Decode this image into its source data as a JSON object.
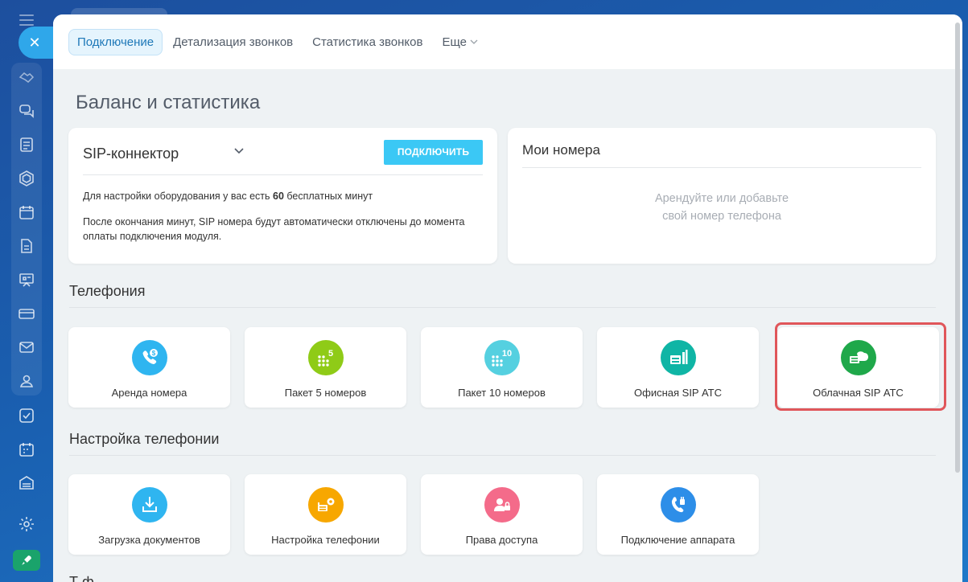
{
  "rail": {
    "close_glyph": "✕",
    "icons": [
      "handshake-icon",
      "chat-icon",
      "feed-icon",
      "hexagon-icon",
      "calendar-icon",
      "document-icon",
      "presentation-icon",
      "card-icon",
      "mail-icon",
      "contacts-icon",
      "task-icon",
      "schedule-icon",
      "storage-icon",
      "settings-icon",
      "rocket-icon"
    ]
  },
  "tabs": [
    {
      "label": "Подключение",
      "active": true
    },
    {
      "label": "Детализация звонков",
      "active": false
    },
    {
      "label": "Статистика звонков",
      "active": false
    },
    {
      "label": "Еще",
      "active": false
    }
  ],
  "page_title": "Баланс и статистика",
  "sip": {
    "title": "SIP-коннектор",
    "button": "ПОДКЛЮЧИТЬ",
    "line1_prefix": "Для настройки оборудования у вас есть ",
    "line1_bold": "60",
    "line1_suffix": " бесплатных минут",
    "line2": "После окончания минут, SIP номера будут автоматически отключены до момента оплаты подключения модуля."
  },
  "my_numbers": {
    "title": "Мои номера",
    "empty_line1": "Арендуйте или добавьте",
    "empty_line2": "свой номер телефона"
  },
  "telephony": {
    "title": "Телефония",
    "tiles": [
      {
        "label": "Аренда номера",
        "color": "#2fb5f0",
        "icon": "phone-dollar-icon"
      },
      {
        "label": "Пакет 5 номеров",
        "color": "#8fcb17",
        "icon": "keypad-5-icon"
      },
      {
        "label": "Пакет 10 номеров",
        "color": "#55d0e0",
        "icon": "keypad-10-icon"
      },
      {
        "label": "Офисная SIP АТС",
        "color": "#0fb5a5",
        "icon": "office-pbx-icon"
      },
      {
        "label": "Облачная SIP АТС",
        "color": "#1fa84a",
        "icon": "cloud-pbx-icon"
      }
    ]
  },
  "setup": {
    "title": "Настройка телефонии",
    "tiles": [
      {
        "label": "Загрузка документов",
        "color": "#2fb5f0",
        "icon": "download-document-icon"
      },
      {
        "label": "Настройка телефонии",
        "color": "#f7a700",
        "icon": "phone-settings-icon"
      },
      {
        "label": "Права доступа",
        "color": "#f46b8a",
        "icon": "access-rights-icon"
      },
      {
        "label": "Подключение аппарата",
        "color": "#2d8ee8",
        "icon": "device-plug-icon"
      }
    ]
  },
  "next_section_peek": "Т     ф"
}
